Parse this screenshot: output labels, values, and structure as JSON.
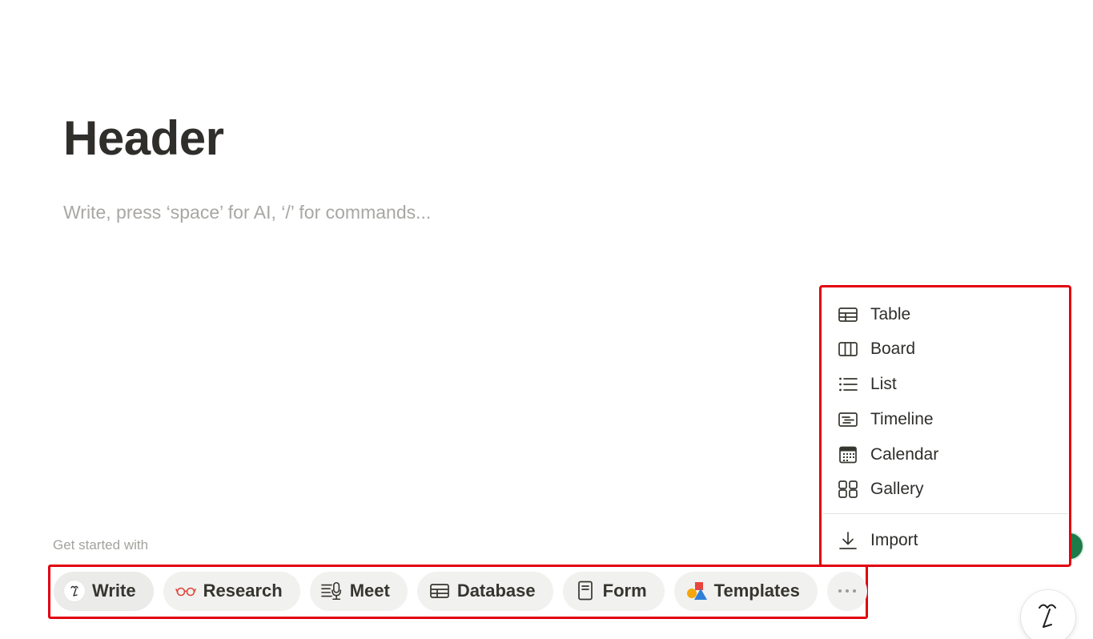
{
  "page": {
    "title": "Header",
    "placeholder": "Write, press ‘space’ for AI, ‘/’ for commands..."
  },
  "get_started": {
    "label": "Get started with",
    "chips": [
      {
        "label": "Write",
        "icon": "ai-face-icon"
      },
      {
        "label": "Research",
        "icon": "glasses-icon"
      },
      {
        "label": "Meet",
        "icon": "meeting-notes-mic-icon"
      },
      {
        "label": "Database",
        "icon": "table-icon"
      },
      {
        "label": "Form",
        "icon": "form-icon"
      },
      {
        "label": "Templates",
        "icon": "templates-shapes-icon"
      },
      {
        "label": "",
        "icon": "more-dots-icon"
      }
    ]
  },
  "database_menu": {
    "items": [
      {
        "label": "Table",
        "icon": "table-icon"
      },
      {
        "label": "Board",
        "icon": "board-icon"
      },
      {
        "label": "List",
        "icon": "list-icon"
      },
      {
        "label": "Timeline",
        "icon": "timeline-icon"
      },
      {
        "label": "Calendar",
        "icon": "calendar-icon"
      },
      {
        "label": "Gallery",
        "icon": "gallery-icon"
      }
    ],
    "import_label": "Import",
    "import_icon": "download-icon"
  },
  "colors": {
    "highlight": "#e3000f",
    "chip_bg": "#f1f1ef",
    "placeholder": "#a8a7a3",
    "glasses": "#e0463a"
  }
}
